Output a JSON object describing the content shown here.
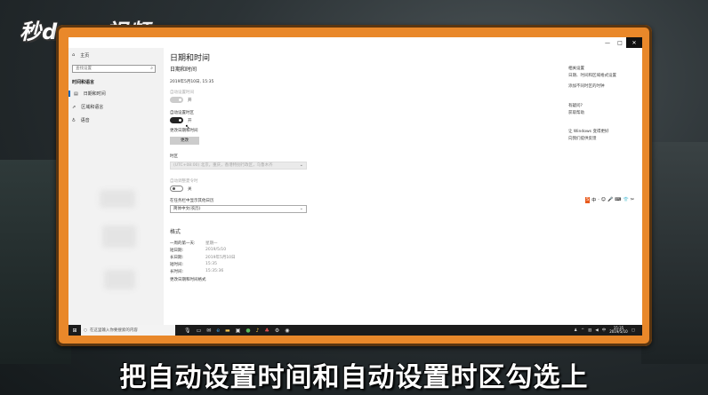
{
  "watermark": {
    "logo": "秒dong视频"
  },
  "window": {
    "controls": [
      "—",
      "□",
      "✕"
    ]
  },
  "sidebar": {
    "home_icon": "home-icon",
    "home_label": "主页",
    "search_placeholder": "查找设置",
    "section": "时间和语言",
    "items": [
      {
        "icon": "calendar-icon",
        "label": "日期和时间"
      },
      {
        "icon": "region-icon",
        "label": "区域和语言"
      },
      {
        "icon": "microphone-icon",
        "label": "语音"
      }
    ]
  },
  "main": {
    "page_title": "日期和时间",
    "section_title": "日期和时间",
    "current_time": "2019年5月10日, 15:35",
    "auto_time_label": "自动设置时间",
    "auto_time_state": "开",
    "auto_timezone_label": "自动设置时区",
    "auto_timezone_state": "开",
    "change_datetime_label": "更改日期和时间",
    "change_button": "更改",
    "timezone_label": "时区",
    "timezone_value": "(UTC+08:00) 北京，重庆，香港特别行政区，乌鲁木齐",
    "dst_label": "自动调整夏令时",
    "dst_state": "关",
    "extra_calendar_label": "在任务栏中显示其他日历",
    "extra_calendar_value": "简体中文(农历)",
    "format_title": "格式",
    "format_rows": [
      {
        "label": "一周的第一天:",
        "value": "星期一"
      },
      {
        "label": "短日期:",
        "value": "2019/5/10"
      },
      {
        "label": "长日期:",
        "value": "2019年5月10日"
      },
      {
        "label": "短时间:",
        "value": "15:35"
      },
      {
        "label": "长时间:",
        "value": "15:35:36"
      }
    ],
    "change_format_link": "更改日期和时间格式"
  },
  "right": {
    "related_title": "相关设置",
    "related_links": [
      "日期、时间和区域格式设置",
      "添加不同时区的时钟"
    ],
    "question_title": "有疑问?",
    "help_link": "获取帮助",
    "improve_title": "让 Windows 变得更好",
    "feedback_link": "向我们提供反馈"
  },
  "ime_bar": {
    "items": [
      "S",
      "中",
      "·",
      "☺",
      "🎤",
      "⌨",
      "👕",
      "✂"
    ]
  },
  "taskbar": {
    "search_placeholder": "在这里输入你要搜索的内容",
    "clock_time": "15:35",
    "clock_date": "2019/5/10"
  },
  "subtitle": "把自动设置时间和自动设置时区勾选上"
}
